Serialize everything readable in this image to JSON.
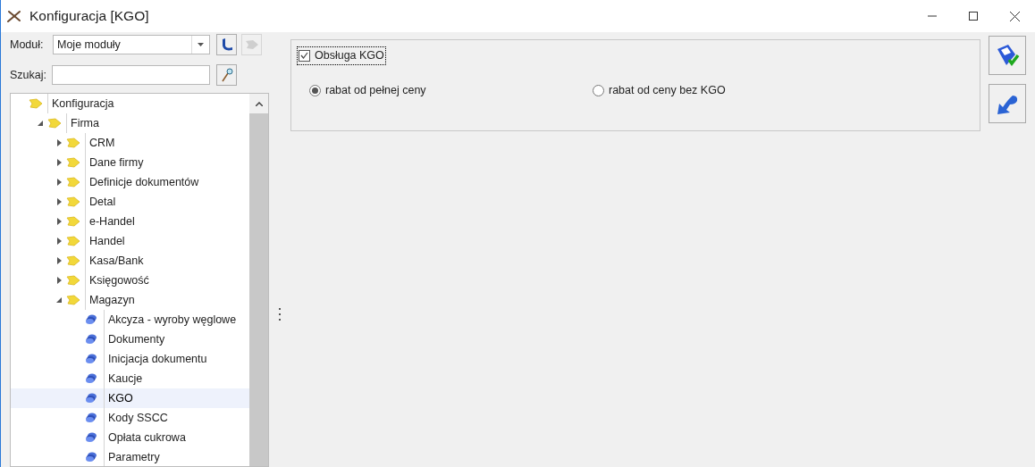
{
  "window": {
    "title": "Konfiguracja [KGO]"
  },
  "module": {
    "label": "Moduł:",
    "value": "Moje moduły"
  },
  "search": {
    "label": "Szukaj:"
  },
  "tree": [
    {
      "label": "Konfiguracja",
      "kind": "folder",
      "selected": false,
      "children": [
        {
          "label": "Firma",
          "kind": "folder",
          "expanded": true,
          "selected": false,
          "children": [
            {
              "label": "CRM",
              "kind": "folder",
              "expanded": false,
              "selected": false
            },
            {
              "label": "Dane firmy",
              "kind": "folder",
              "expanded": false,
              "selected": false
            },
            {
              "label": "Definicje dokumentów",
              "kind": "folder",
              "expanded": false,
              "selected": false
            },
            {
              "label": "Detal",
              "kind": "folder",
              "expanded": false,
              "selected": false
            },
            {
              "label": "e-Handel",
              "kind": "folder",
              "expanded": false,
              "selected": false
            },
            {
              "label": "Handel",
              "kind": "folder",
              "expanded": false,
              "selected": false
            },
            {
              "label": "Kasa/Bank",
              "kind": "folder",
              "expanded": false,
              "selected": false
            },
            {
              "label": "Księgowość",
              "kind": "folder",
              "expanded": false,
              "selected": false
            },
            {
              "label": "Magazyn",
              "kind": "folder",
              "expanded": true,
              "selected": false,
              "children": [
                {
                  "label": "Akcyza - wyroby węglowe",
                  "kind": "leaf",
                  "selected": false
                },
                {
                  "label": "Dokumenty",
                  "kind": "leaf",
                  "selected": false
                },
                {
                  "label": "Inicjacja dokumentu",
                  "kind": "leaf",
                  "selected": false
                },
                {
                  "label": "Kaucje",
                  "kind": "leaf",
                  "selected": false
                },
                {
                  "label": "KGO",
                  "kind": "leaf",
                  "selected": true
                },
                {
                  "label": "Kody SSCC",
                  "kind": "leaf",
                  "selected": false
                },
                {
                  "label": "Opłata cukrowa",
                  "kind": "leaf",
                  "selected": false
                },
                {
                  "label": "Parametry",
                  "kind": "leaf",
                  "selected": false
                }
              ]
            }
          ]
        }
      ]
    }
  ],
  "settings": {
    "checkbox": {
      "label": "Obsługa KGO",
      "checked": true
    },
    "options": [
      {
        "label": "rabat od pełnej ceny",
        "selected": true
      },
      {
        "label": "rabat od ceny bez KGO",
        "selected": false
      }
    ]
  }
}
